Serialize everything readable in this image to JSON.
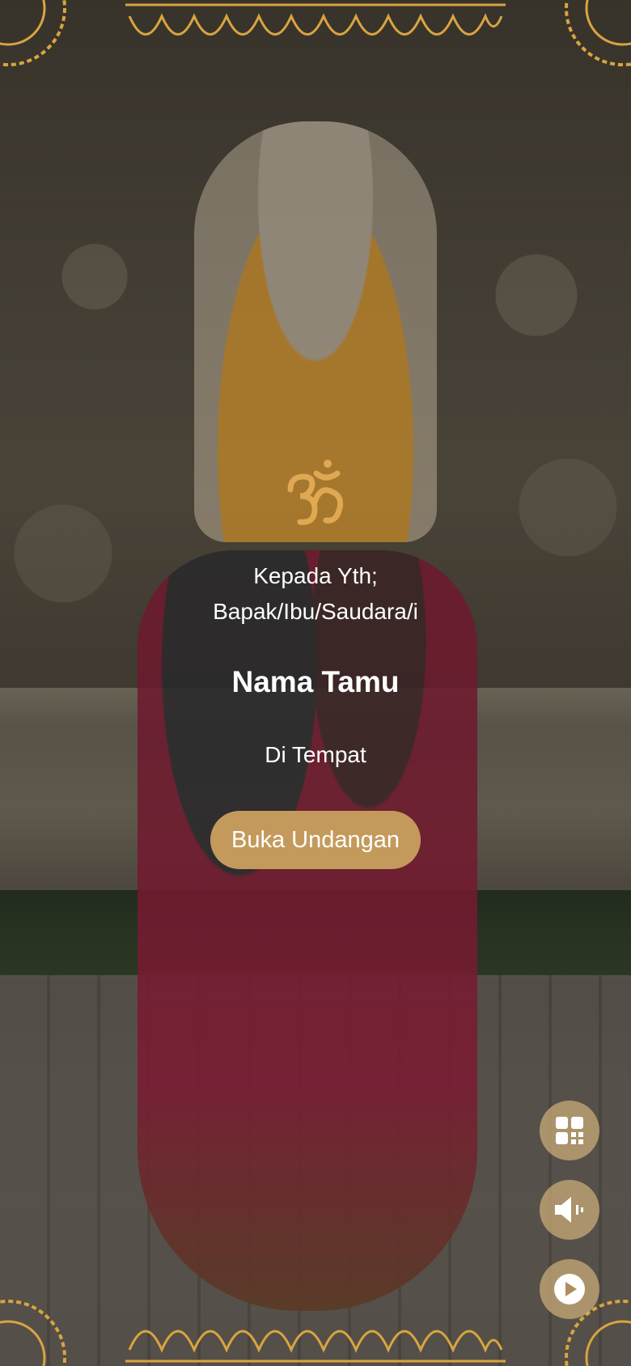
{
  "greeting": {
    "line1": "Kepada Yth;",
    "line2": "Bapak/Ibu/Saudara/i"
  },
  "guest_name": "Nama Tamu",
  "place": "Di Tempat",
  "open_button_label": "Buka Undangan",
  "icons": {
    "om": "om-symbol-icon",
    "qr": "qr-code-icon",
    "sound": "speaker-icon",
    "play": "play-icon"
  },
  "colors": {
    "accent": "#c49a5c",
    "gold": "#d9a441"
  }
}
